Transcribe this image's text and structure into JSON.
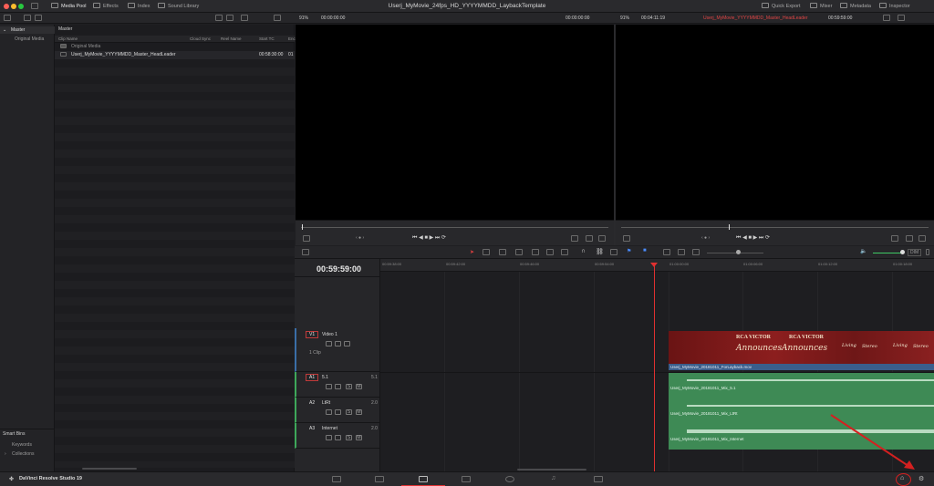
{
  "titlebar": {
    "project_title": "Userj_MyMovie_24fps_HD_YYYYMMDD_LaybackTemplate",
    "media_pool": "Media Pool",
    "effects": "Effects",
    "index": "Index",
    "sound_library": "Sound Library",
    "quick_export": "Quick Export",
    "mixer": "Mixer",
    "metadata": "Metadata",
    "inspector": "Inspector"
  },
  "viewer_bar": {
    "src_zoom": "91%",
    "src_tc": "00:00:00:00",
    "src_duration": "00:00:00:00",
    "tl_zoom": "91%",
    "tl_duration": "00:04:11:19",
    "timeline_name": "Userj_MyMovie_YYYYMMDD_Master_HeadLeader",
    "tl_tc": "00:59:59:00"
  },
  "bins": {
    "master": "Master",
    "original_media": "Original Media",
    "smart_bins": "Smart Bins",
    "keywords": "Keywords",
    "collections": "Collections"
  },
  "media_pool": {
    "header": "Master",
    "columns": [
      "Clip Name",
      "Cloud Sync",
      "Reel Name",
      "Start TC",
      "Enc"
    ],
    "rows": [
      {
        "name": "Original Media",
        "start": ""
      },
      {
        "name": "Userj_MyMovie_YYYYMMDD_Master_HeadLeader",
        "start": "00:58:30:00",
        "extra": "01"
      }
    ]
  },
  "timeline": {
    "timecode": "00:59:59:00",
    "ruler_ticks": [
      "00:59:38:00",
      "00:59:42:00",
      "00:59:46:00",
      "00:59:54:00",
      "01:00:00:00",
      "01:00:06:00",
      "01:00:12:00",
      "01:00:18:00"
    ],
    "dim": "DIM",
    "tracks": {
      "v1_tag": "V1",
      "v1_name": "Video 1",
      "v1_clips": "1 Clip",
      "a1_tag": "A1",
      "a1_name": "5.1",
      "a1_ch": "5.1",
      "a2_tag": "A2",
      "a2_name": "LtRt",
      "a2_ch": "2.0",
      "a3_tag": "A3",
      "a3_name": "Internet",
      "a3_ch": "2.0",
      "solo": "S",
      "mute": "M"
    },
    "clips": {
      "video": "Userj_MyMovie_20181011_ForLayback.mov",
      "audio1": "Userj_MyMovie_20181011_Mix_5.1",
      "audio2": "Userj_MyMovie_20181011_Mix_LtRt",
      "audio3": "Userj_MyMovie_20181011_Mix_Internet",
      "thumb_text1": "RCA VICTOR",
      "thumb_text2": "RCA VICTOR",
      "thumb_script1": "Announces",
      "thumb_script2": "Announces",
      "thumb_living1": "Living",
      "thumb_stereo1": "Stereo",
      "thumb_living2": "Living",
      "thumb_stereo2": "Stereo"
    }
  },
  "footer": {
    "app_name": "DaVinci Resolve Studio 19"
  },
  "colors": {
    "accent_red": "#e03030",
    "audio_clip": "#3e8a55",
    "video_label": "#3a5e8c"
  }
}
